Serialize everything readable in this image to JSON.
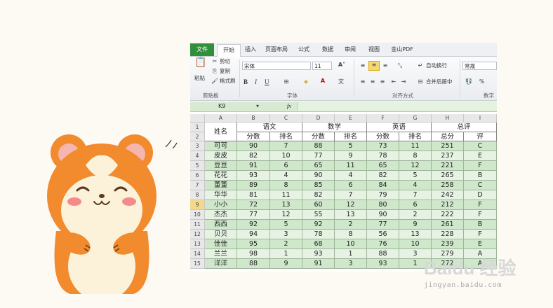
{
  "ribbon": {
    "tabs": [
      "文件",
      "开始",
      "插入",
      "页面布局",
      "公式",
      "数据",
      "审阅",
      "视图",
      "金山PDF"
    ],
    "clipboard": {
      "paste": "粘贴",
      "cut": "剪切",
      "copy": "复制",
      "format_painter": "格式刷",
      "group": "剪贴板"
    },
    "font": {
      "name": "宋体",
      "size": "11",
      "group": "字体",
      "bold": "B",
      "italic": "I",
      "underline": "U"
    },
    "alignment": {
      "wrap": "自动换行",
      "merge": "合并后居中",
      "group": "对齐方式"
    },
    "number": {
      "format": "常规",
      "group": "数字",
      "percent": "%"
    }
  },
  "formula_bar": {
    "name_box": "K9",
    "fx": "fx"
  },
  "columns": [
    "A",
    "B",
    "C",
    "D",
    "E",
    "F",
    "G",
    "H",
    "I"
  ],
  "rows": [
    "1",
    "2",
    "3",
    "4",
    "5",
    "6",
    "7",
    "8",
    "9",
    "10",
    "11",
    "12",
    "13",
    "14",
    "15"
  ],
  "selected_row": "9",
  "header": {
    "name": "姓名",
    "chinese": "语文",
    "math": "数学",
    "english": "英语",
    "overall": "总评",
    "score": "分数",
    "rank": "排名",
    "total": "总分",
    "grade": "评"
  },
  "table": [
    [
      "可可",
      "90",
      "7",
      "88",
      "5",
      "73",
      "11",
      "251",
      "C"
    ],
    [
      "皮皮",
      "82",
      "10",
      "77",
      "9",
      "78",
      "8",
      "237",
      "E"
    ],
    [
      "豆豆",
      "91",
      "6",
      "65",
      "11",
      "65",
      "12",
      "221",
      "F"
    ],
    [
      "花花",
      "93",
      "4",
      "90",
      "4",
      "82",
      "5",
      "265",
      "B"
    ],
    [
      "董董",
      "89",
      "8",
      "85",
      "6",
      "84",
      "4",
      "258",
      "C"
    ],
    [
      "华华",
      "81",
      "11",
      "82",
      "7",
      "79",
      "7",
      "242",
      "D"
    ],
    [
      "小小",
      "72",
      "13",
      "60",
      "12",
      "80",
      "6",
      "212",
      "F"
    ],
    [
      "杰杰",
      "77",
      "12",
      "55",
      "13",
      "90",
      "2",
      "222",
      "F"
    ],
    [
      "西西",
      "92",
      "5",
      "92",
      "2",
      "77",
      "9",
      "261",
      "B"
    ],
    [
      "贝贝",
      "94",
      "3",
      "78",
      "8",
      "56",
      "13",
      "228",
      "F"
    ],
    [
      "佳佳",
      "95",
      "2",
      "68",
      "10",
      "76",
      "10",
      "239",
      "E"
    ],
    [
      "兰兰",
      "98",
      "1",
      "93",
      "1",
      "88",
      "3",
      "279",
      "A"
    ],
    [
      "洋洋",
      "88",
      "9",
      "91",
      "3",
      "93",
      "1",
      "272",
      "A"
    ]
  ],
  "watermark": {
    "brand": "Baidu 经验",
    "url": "jingyan.baidu.com"
  },
  "colors": {
    "file_tab": "#2f8f3a",
    "row_odd": "#cfe7cb",
    "row_even": "#e6f3e3",
    "hamster": "#f28a2e",
    "belly": "#fbf2d9"
  }
}
